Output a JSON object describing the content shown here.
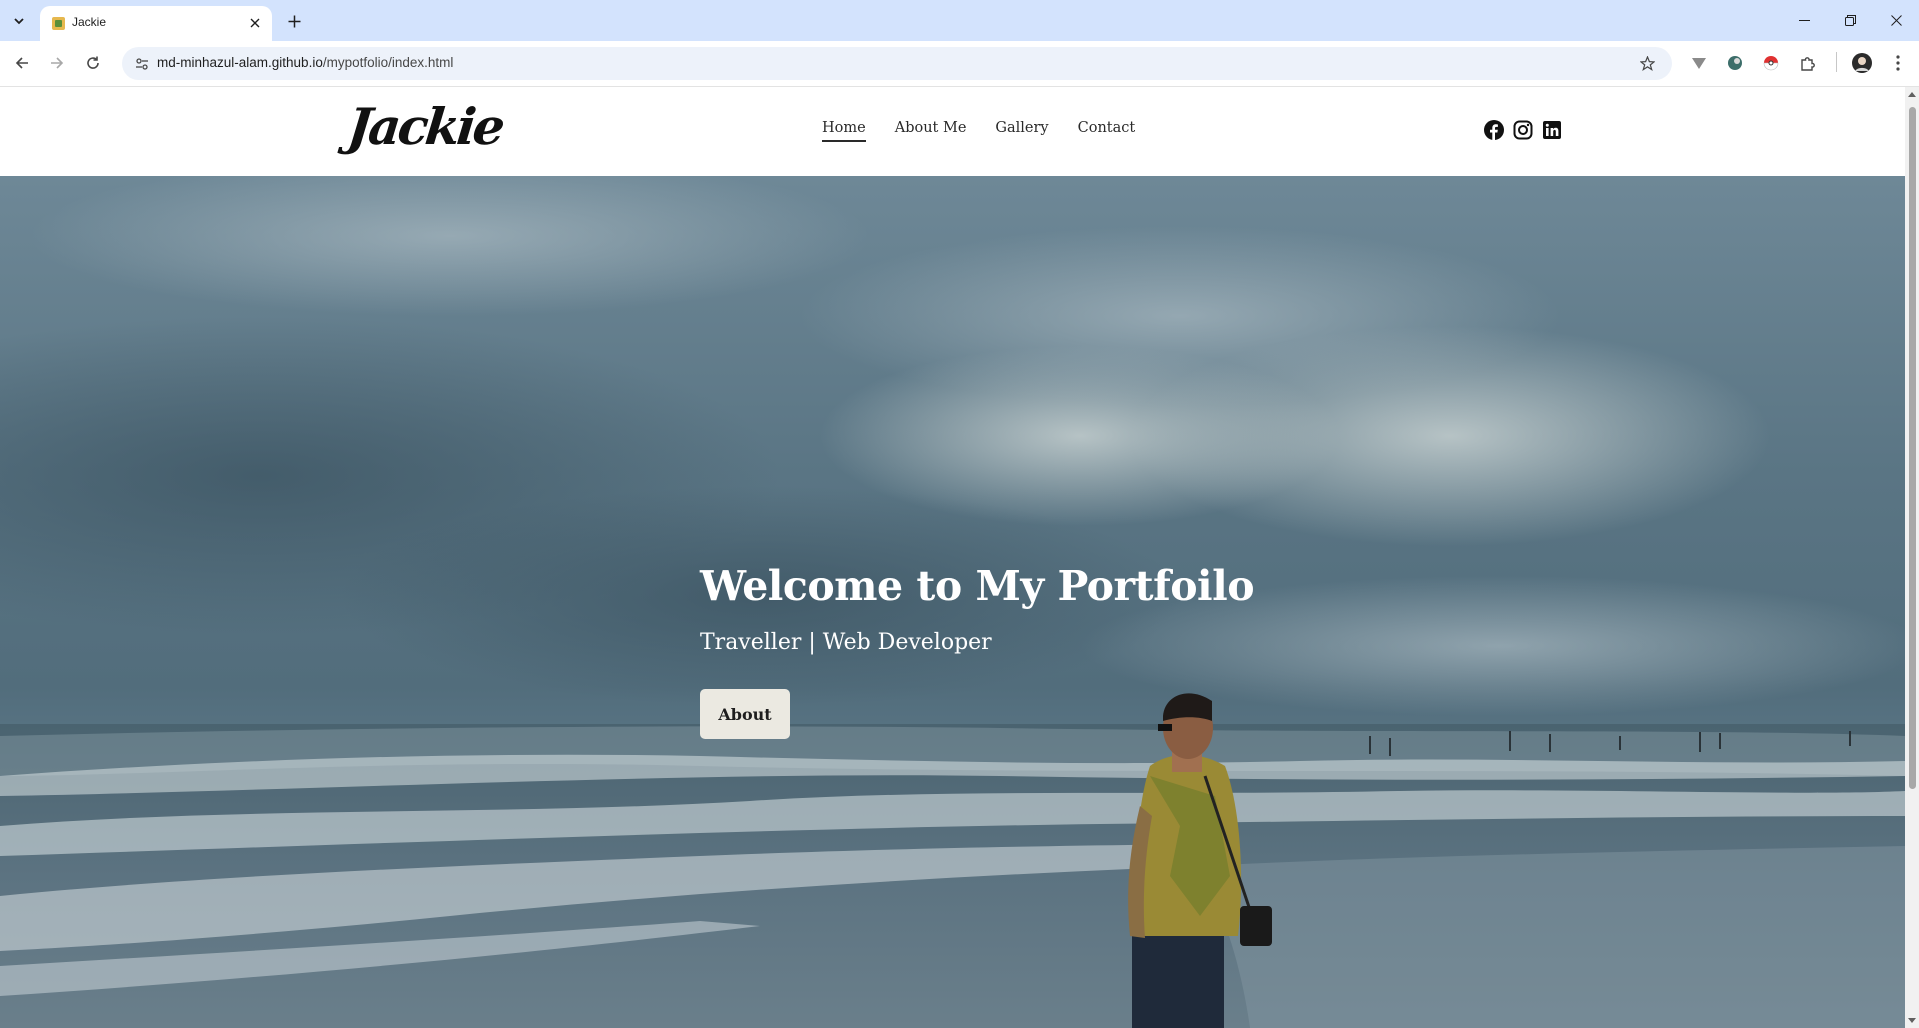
{
  "browser": {
    "tab_title": "Jackie",
    "url_host": "md-minhazul-alam.github.io",
    "url_path": "/mypotfolio/index.html"
  },
  "site": {
    "logo": "Jackie",
    "nav": [
      {
        "label": "Home",
        "active": true
      },
      {
        "label": "About Me",
        "active": false
      },
      {
        "label": "Gallery",
        "active": false
      },
      {
        "label": "Contact",
        "active": false
      }
    ],
    "socials": [
      "facebook-icon",
      "instagram-icon",
      "linkedin-icon"
    ]
  },
  "hero": {
    "title": "Welcome to My Portfoilo",
    "subtitle": "Traveller | Web Developer",
    "button_label": "About"
  },
  "colors": {
    "tabstrip": "#d3e3fd",
    "omnibox": "#edf2fa",
    "hero_button": "#ebe9e1"
  }
}
